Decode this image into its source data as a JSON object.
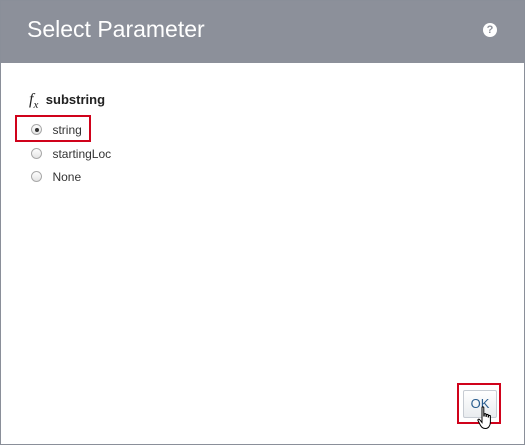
{
  "dialog": {
    "title": "Select Parameter",
    "help_icon": "question-circle-icon",
    "help_glyph": "?"
  },
  "function": {
    "icon": "fx-icon",
    "name": "substring"
  },
  "parameters": [
    {
      "label": "string",
      "selected": true
    },
    {
      "label": "startingLoc",
      "selected": false
    },
    {
      "label": "None",
      "selected": false
    }
  ],
  "buttons": {
    "ok_label": "OK"
  },
  "colors": {
    "titlebar": "#8c909a",
    "highlight": "#d0021b",
    "ok_text": "#2a5d8f"
  }
}
